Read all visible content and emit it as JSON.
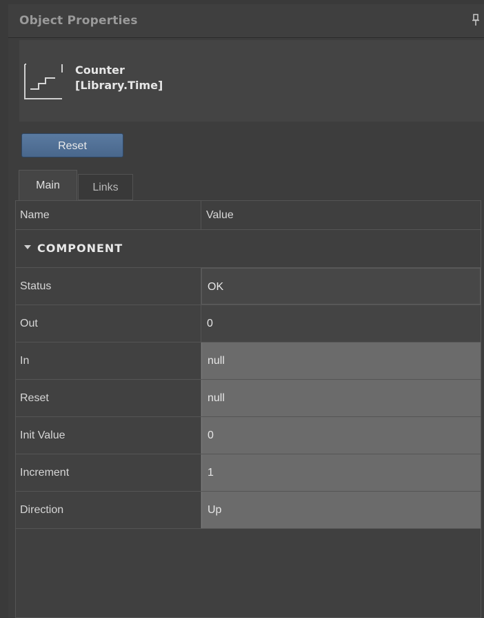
{
  "panel": {
    "title": "Object Properties"
  },
  "object": {
    "name": "Counter",
    "type": "[Library.Time]",
    "icon": "step-counter-icon"
  },
  "toolbar": {
    "reset_label": "Reset"
  },
  "tabs": [
    {
      "label": "Main",
      "active": true
    },
    {
      "label": "Links",
      "active": false
    }
  ],
  "grid": {
    "columns": {
      "name": "Name",
      "value": "Value"
    },
    "category": "COMPONENT",
    "rows": [
      {
        "name": "Status",
        "value": "OK",
        "editable": false
      },
      {
        "name": "Out",
        "value": "0",
        "editable": false
      },
      {
        "name": "In",
        "value": "null",
        "editable": true
      },
      {
        "name": "Reset",
        "value": "null",
        "editable": true
      },
      {
        "name": "Init Value",
        "value": "0",
        "editable": true
      },
      {
        "name": "Increment",
        "value": "1",
        "editable": true
      },
      {
        "name": "Direction",
        "value": "Up",
        "editable": true
      }
    ]
  },
  "colors": {
    "accent_button": "#5a7aa0",
    "editable_cell": "#6b6b6b",
    "background": "#3d3d3d"
  }
}
